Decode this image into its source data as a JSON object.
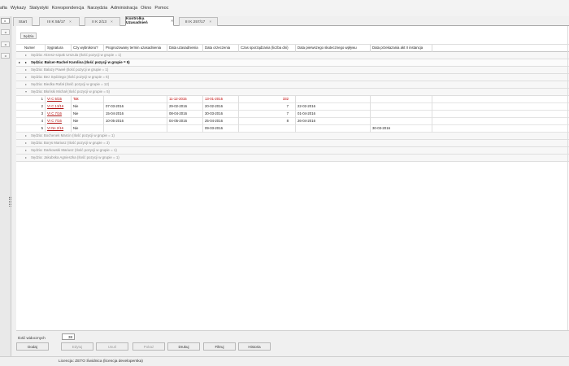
{
  "menu": [
    "afia",
    "Wykazy",
    "Statystyki",
    "Korespondencja",
    "Narzędzia",
    "Administracja",
    "Okno",
    "Pomoc"
  ],
  "left": {
    "arrows": [
      "▸",
      "◂",
      "◂",
      "◂"
    ]
  },
  "tabs": [
    {
      "label": "Start"
    },
    {
      "label": "III K 55/17",
      "close": "×"
    },
    {
      "label": "II K 2/13",
      "close": "×"
    },
    {
      "label": "Kontrolka Uzasadnień",
      "close": "×"
    },
    {
      "label": "III K 257/17",
      "close": "×"
    }
  ],
  "group_by": "Sędzia",
  "columns": [
    "Numer",
    "Sygnatura",
    "Czy wybrołono?",
    "Prognozowany termin uzasadnienia",
    "Data uzasadnienia",
    "Data orzeczenia",
    "Czas sporządzania (liczba dni)",
    "Data pierwszego skutecznego wpływu",
    "Data przekazania akt II instancja"
  ],
  "groups_top": [
    {
      "label": "Sędzia: Akresz-szpak Urszula  (Ilość pozycji w grupie = 1)",
      "arrow": "▸",
      "mark": ""
    },
    {
      "label": "Sędzia: Balcer-Rachel Karolina  (Ilość pozycji w grupie = 5)",
      "arrow": "▸",
      "mark": "▸"
    },
    {
      "label": "Sędzia: Balazy Paweł  (Ilość pozycji w grupie = 1)",
      "arrow": "▸",
      "mark": ""
    },
    {
      "label": "Sędzia: Bez Sędziego  (Ilość pozycji w grupie = 6)",
      "arrow": "▸",
      "mark": ""
    },
    {
      "label": "Sędzia: Biedka Rafał  (Ilość pozycji w grupie = 12)",
      "arrow": "▸",
      "mark": ""
    },
    {
      "label": "Sędzia: Błoński Michał  (Ilość pozycji w grupie = 5)",
      "arrow": "▾",
      "mark": ""
    }
  ],
  "rows": [
    {
      "num": "1",
      "sig": "VI C 5/15",
      "wyb": "Tak",
      "prog": "",
      "uz": "11-12-2015",
      "orz": "13-01-2015",
      "czas": "332",
      "wplyw": "",
      "akt": ""
    },
    {
      "num": "2",
      "sig": "VI C 13/16",
      "wyb": "Nie",
      "prog": "07-03-2016",
      "uz": "29-02-2016",
      "orz": "20-02-2016",
      "czas": "7",
      "wplyw": "22-02-2016",
      "akt": ""
    },
    {
      "num": "3",
      "sig": "VI C 7/16",
      "wyb": "Nie",
      "prog": "15-04-2016",
      "uz": "08-04-2016",
      "orz": "30-03-2016",
      "czas": "7",
      "wplyw": "01-04-2016",
      "akt": ""
    },
    {
      "num": "4",
      "sig": "VI C 7/16",
      "wyb": "Nie",
      "prog": "10-05-2016",
      "uz": "04-05-2016",
      "orz": "25-04-2016",
      "czas": "8",
      "wplyw": "26-04-2016",
      "akt": ""
    },
    {
      "num": "5",
      "sig": "VI Ns 2/16",
      "wyb": "Nie",
      "prog": "",
      "uz": "",
      "orz": "09-03-2016",
      "czas": "",
      "wplyw": "",
      "akt": "30-03-2016"
    }
  ],
  "groups_bottom": [
    {
      "label": "Sędzia: Bochenek Marcin  (Ilość pozycji w grupie = 1)",
      "arrow": "▸"
    },
    {
      "label": "Sędzia: Borys Mariusz  (Ilość pozycji w grupie = 3)",
      "arrow": "▸"
    },
    {
      "label": "Sędzia: Darkowski Mariusz  (Ilość pozycji w grupie = 1)",
      "arrow": "▸"
    },
    {
      "label": "Sędzia: Jakubska Agnieszka  (Ilość pozycji w grupie = 1)",
      "arrow": "▸"
    }
  ],
  "footer": {
    "count_label": "Ilość widocznych",
    "count_value": "38",
    "buttons": [
      {
        "label": "Dodaj",
        "enabled": true
      },
      {
        "label": "Edytuj",
        "enabled": false
      },
      {
        "label": "Usuń",
        "enabled": false
      },
      {
        "label": "Pokaż",
        "enabled": false
      },
      {
        "label": "Drukuj",
        "enabled": true
      },
      {
        "label": "Filtruj",
        "enabled": true
      },
      {
        "label": "Historia",
        "enabled": true
      }
    ]
  },
  "status": {
    "license": "Licencja: ZETO Świdnica (licencja developerska)"
  }
}
